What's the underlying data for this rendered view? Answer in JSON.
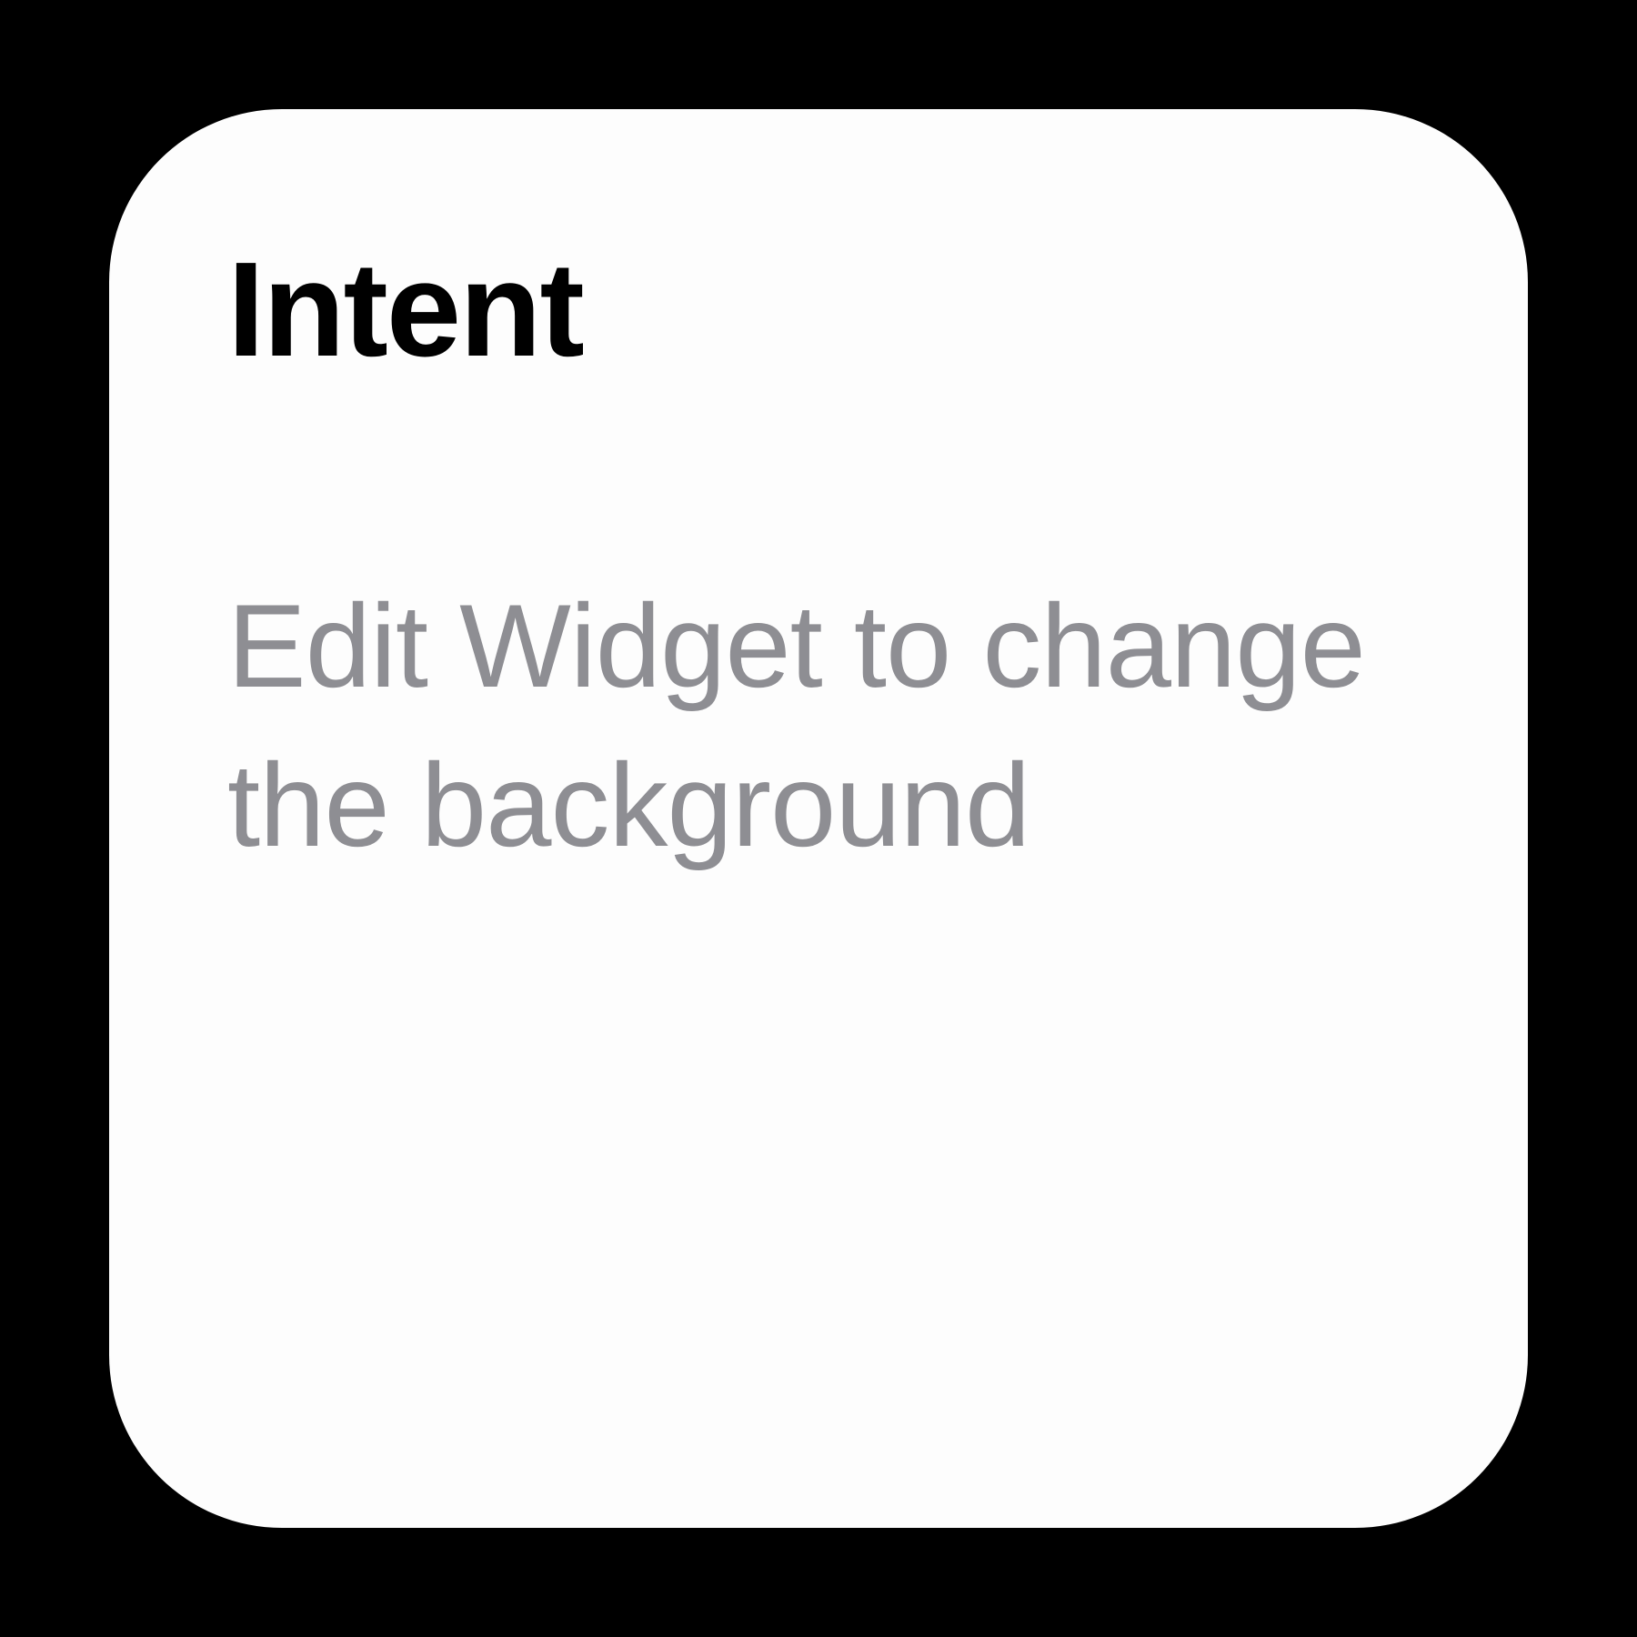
{
  "widget": {
    "title": "Intent",
    "description": "Edit Widget to change the background"
  }
}
